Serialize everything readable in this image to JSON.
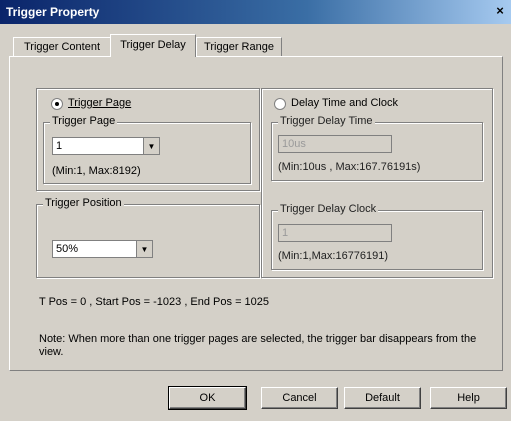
{
  "window": {
    "title": "Trigger Property",
    "close_glyph": "×"
  },
  "tabs": [
    {
      "label": "Trigger Content",
      "active": false
    },
    {
      "label": "Trigger Delay",
      "active": true
    },
    {
      "label": "Trigger Range",
      "active": false
    }
  ],
  "trigger_page": {
    "radio_label": "Trigger Page",
    "selected": true,
    "group_label": "Trigger Page",
    "value": "1",
    "range": "(Min:1, Max:8192)"
  },
  "trigger_position": {
    "group_label": "Trigger Position",
    "value": "50%"
  },
  "delay_time_clock": {
    "radio_label": "Delay Time and Clock",
    "selected": false,
    "delay_time": {
      "group_label": "Trigger Delay Time",
      "value": "10us",
      "range": "(Min:10us , Max:167.76191s)"
    },
    "delay_clock": {
      "group_label": "Trigger Delay Clock",
      "value": "1",
      "range": "(Min:1,Max:16776191)"
    }
  },
  "pos_info": "T Pos = 0 , Start Pos = -1023 , End Pos = 1025",
  "note": "Note: When more than one trigger pages are selected, the trigger bar disappears from the view.",
  "buttons": {
    "ok": "OK",
    "cancel": "Cancel",
    "default": "Default",
    "help": "Help"
  }
}
